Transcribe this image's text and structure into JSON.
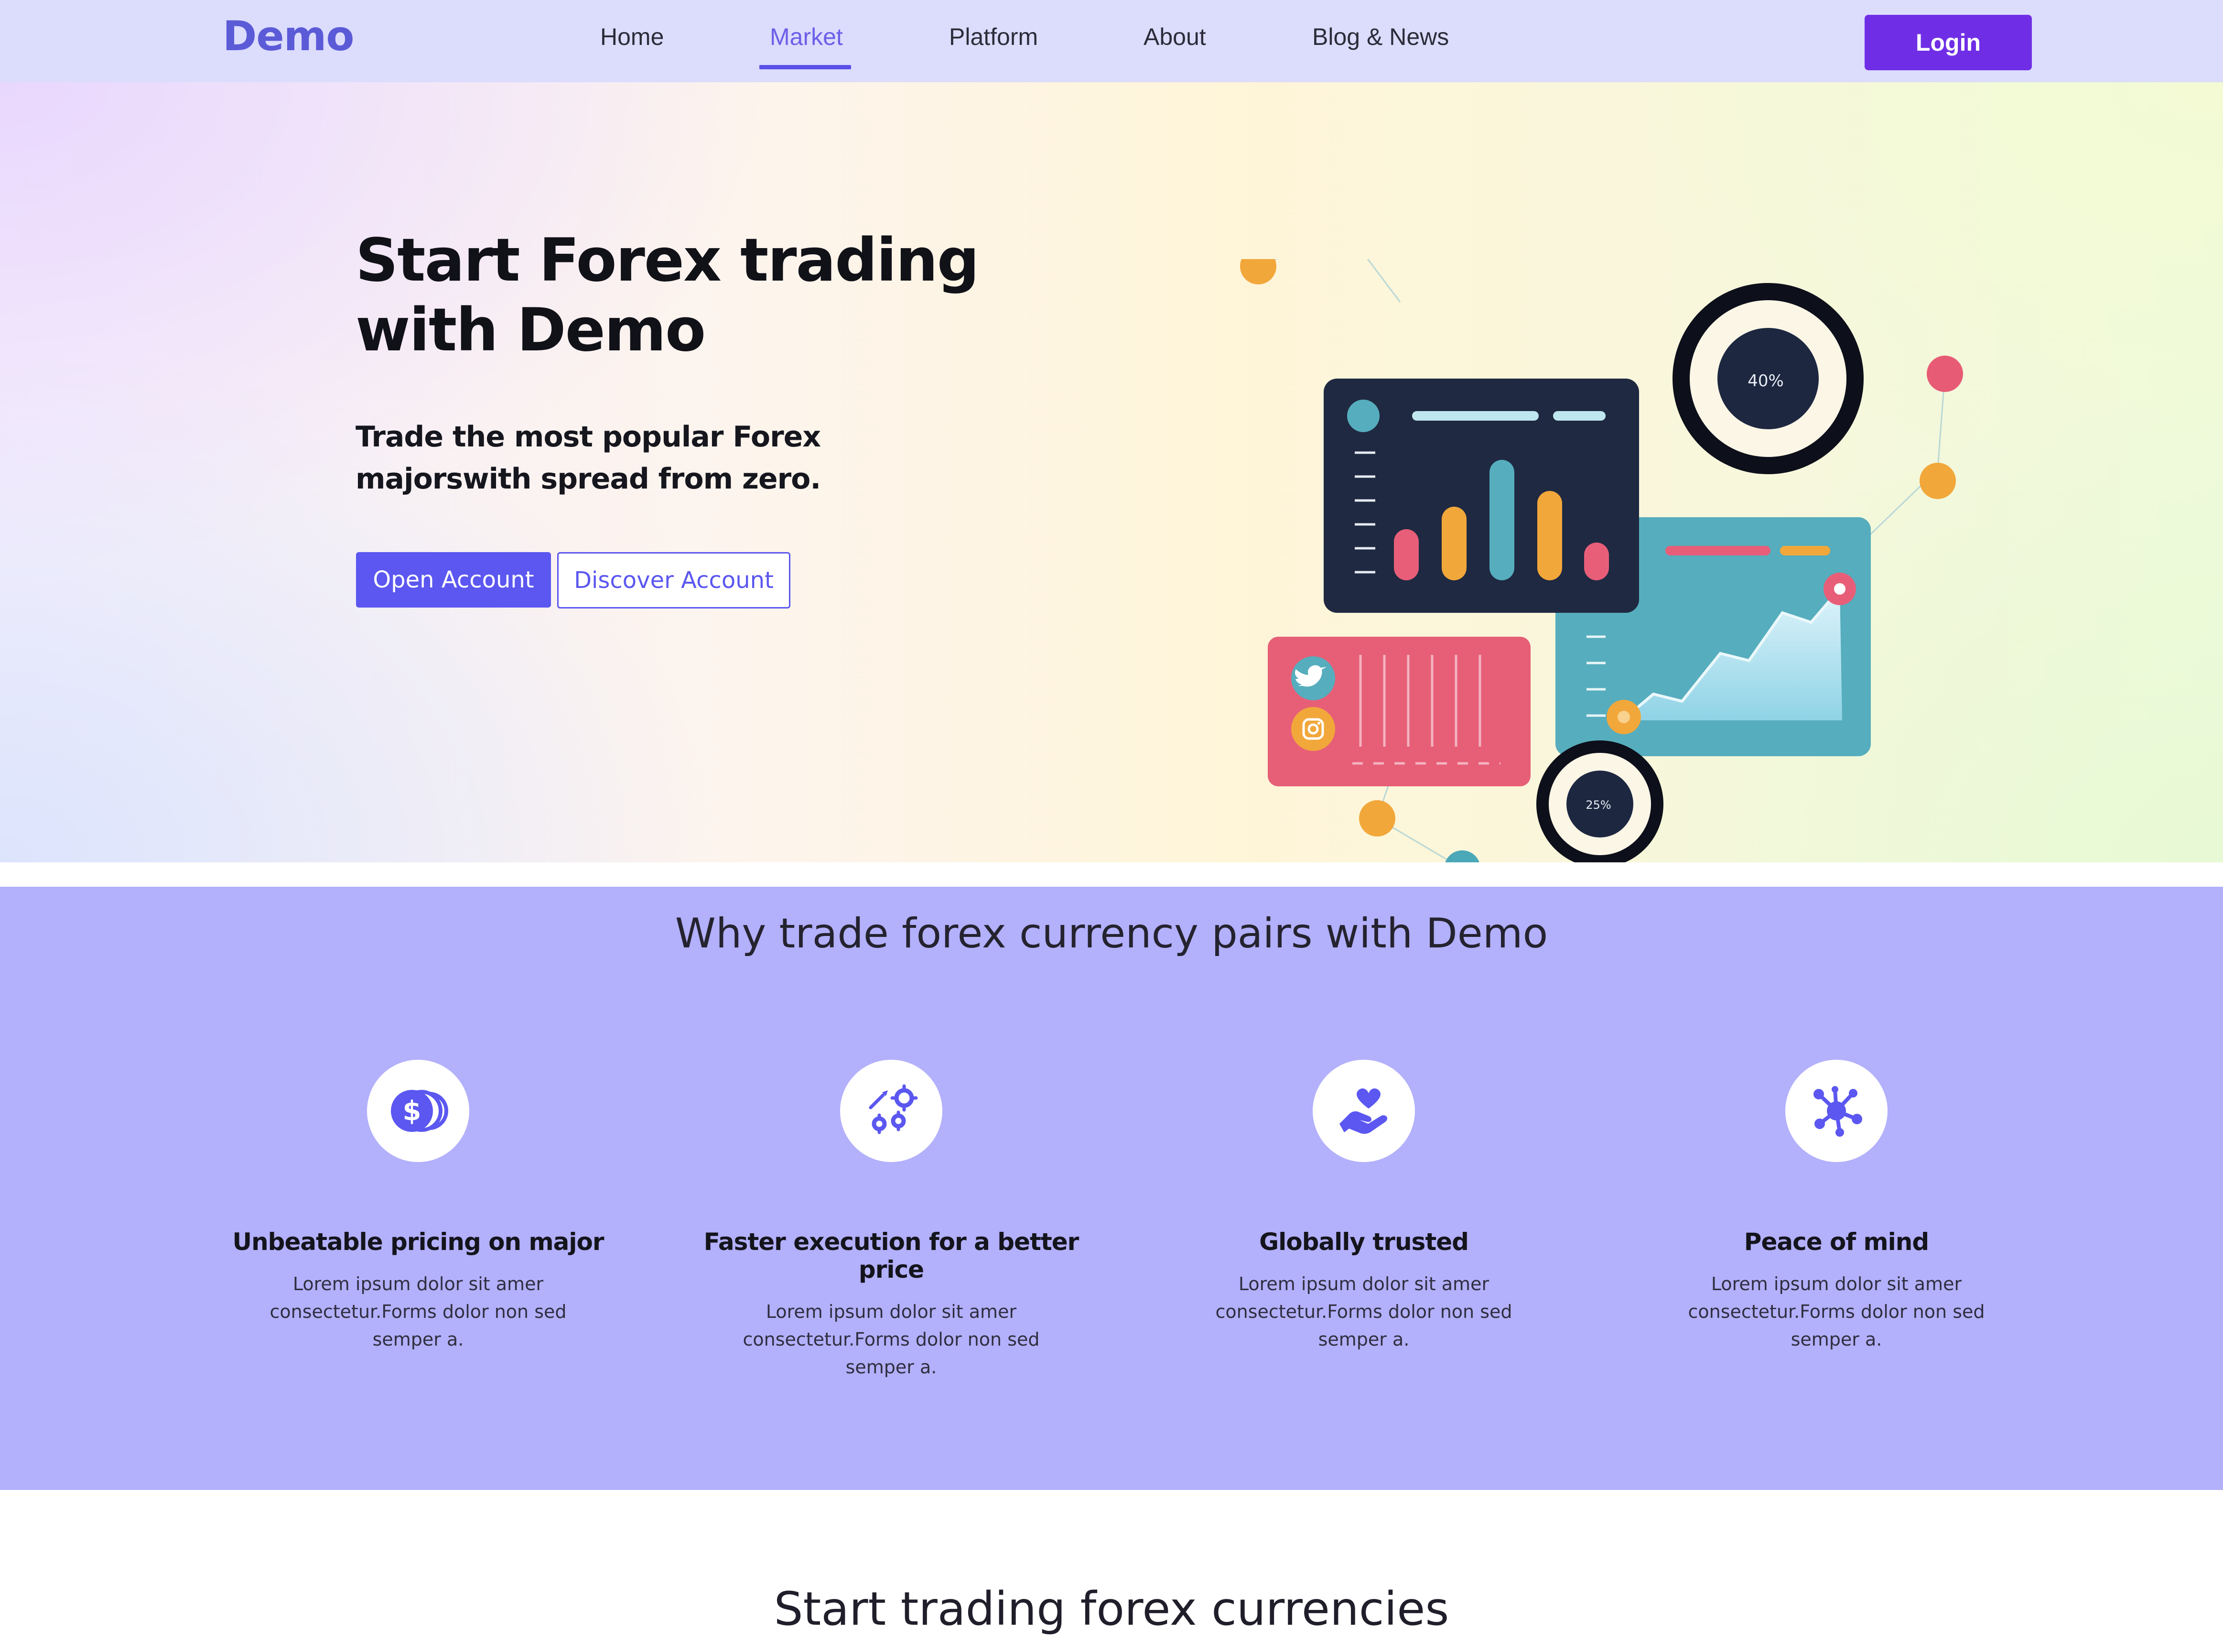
{
  "nav": {
    "brand": "Demo",
    "items": [
      {
        "label": "Home"
      },
      {
        "label": "Market",
        "active": true
      },
      {
        "label": "Platform"
      },
      {
        "label": "About"
      },
      {
        "label": "Blog & News"
      }
    ],
    "login_label": "Login"
  },
  "hero": {
    "title_line1": "Start Forex trading",
    "title_line2": "with Demo",
    "subtitle_line1": "Trade the most popular Forex",
    "subtitle_line2": "majorswith spread from zero.",
    "open_account_label": "Open Account",
    "discover_account_label": "Discover Account",
    "illustration": {
      "ring_large_label": "40%",
      "ring_small_label": "25%",
      "social_icons": [
        "twitter-icon",
        "instagram-icon"
      ]
    }
  },
  "features": {
    "title": "Why trade forex currency pairs with Demo",
    "items": [
      {
        "icon": "coins-dollar-icon",
        "title": "Unbeatable pricing on major",
        "desc": "Lorem ipsum dolor sit amer consectetur.Forms dolor non sed semper a."
      },
      {
        "icon": "gears-execution-icon",
        "title": "Faster execution for a better price",
        "desc": "Lorem ipsum dolor sit amer consectetur.Forms dolor non sed semper a."
      },
      {
        "icon": "heart-hand-icon",
        "title": "Globally trusted",
        "desc": "Lorem ipsum dolor sit amer consectetur.Forms dolor non sed semper a."
      },
      {
        "icon": "network-nodes-icon",
        "title": "Peace of mind",
        "desc": "Lorem ipsum dolor sit amer consectetur.Forms dolor non sed semper a."
      }
    ]
  },
  "bottom": {
    "title": "Start trading forex currencies"
  },
  "colors": {
    "brand": "#5b5ad7",
    "login_button": "#6f2ee6",
    "primary_button": "#5b57f0",
    "features_bg": "#b3b0fc",
    "nav_bg": "#dcdcfd"
  }
}
